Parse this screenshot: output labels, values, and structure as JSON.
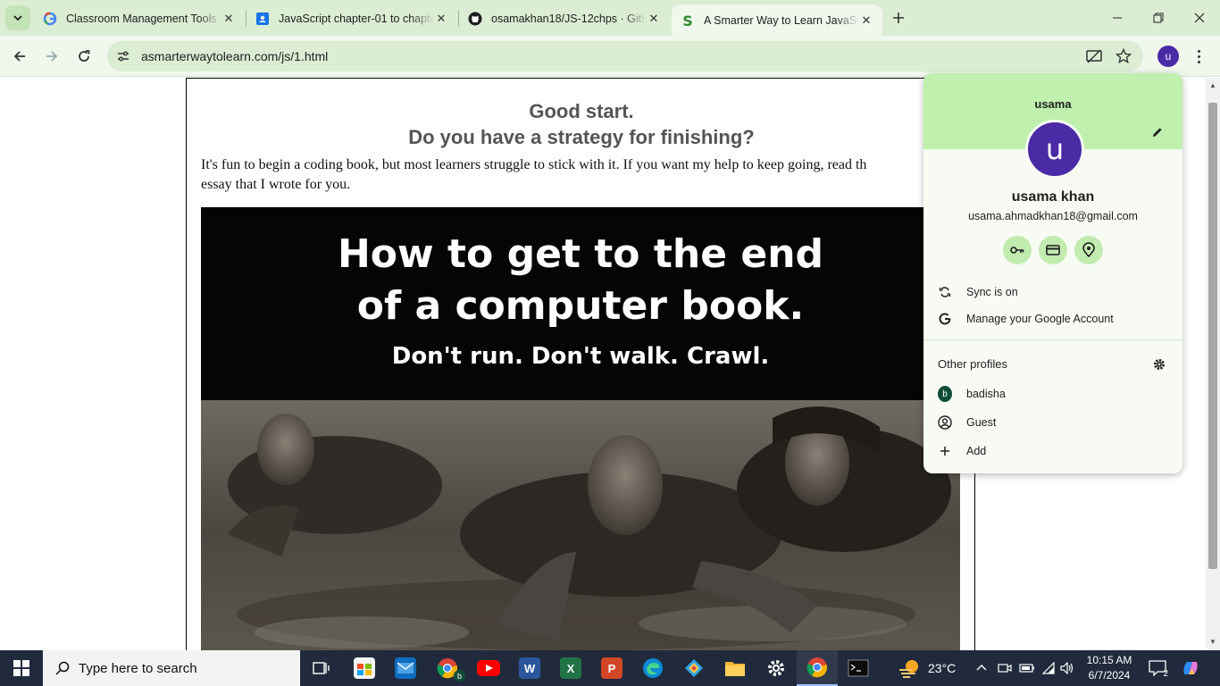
{
  "browser": {
    "tabs": [
      {
        "title": "Classroom Management Tools &",
        "favicon": "google-icon"
      },
      {
        "title": "JavaScript chapter-01 to chapte",
        "favicon": "google-classroom-icon"
      },
      {
        "title": "osamakhan18/JS-12chps · GitHu",
        "favicon": "github-icon"
      },
      {
        "title": "A Smarter Way to Learn JavaSc",
        "favicon": "smarter-way-icon",
        "active": true
      }
    ],
    "url": "asmarterwaytolearn.com/js/1.html",
    "profile_initial": "u"
  },
  "page": {
    "heading_line1": "Good start.",
    "heading_line2": "Do you have a strategy for finishing?",
    "intro": "It's fun to begin a coding book, but most learners struggle to stick with it. If you want my help to keep going, read th\nessay that I wrote for you.",
    "banner_line1": "How to get to the end",
    "banner_line2": "of a computer book.",
    "banner_line3": "Don't run. Don't walk. Crawl."
  },
  "profile_menu": {
    "profile_name": "usama",
    "avatar_initial": "u",
    "full_name": "usama khan",
    "email": "usama.ahmadkhan18@gmail.com",
    "quick_actions": [
      "password-key-icon",
      "payment-card-icon",
      "location-pin-icon"
    ],
    "sync_label": "Sync is on",
    "manage_label": "Manage your Google Account",
    "other_profiles_label": "Other profiles",
    "other_profiles": [
      {
        "name": "badisha",
        "initial": "b"
      },
      {
        "name": "Guest"
      },
      {
        "name": "Add"
      }
    ]
  },
  "taskbar": {
    "search_placeholder": "Type here to search",
    "weather": "23°C",
    "time": "10:15 AM",
    "date": "6/7/2024",
    "notification_count": "2",
    "chrome_profile_badge": "b"
  },
  "colors": {
    "tab_strip": "#dbedd3",
    "toolbar": "#f0f7ed",
    "profile_header": "#bff0ae",
    "avatar": "#4b2aa6",
    "taskbar": "#202a3c"
  }
}
